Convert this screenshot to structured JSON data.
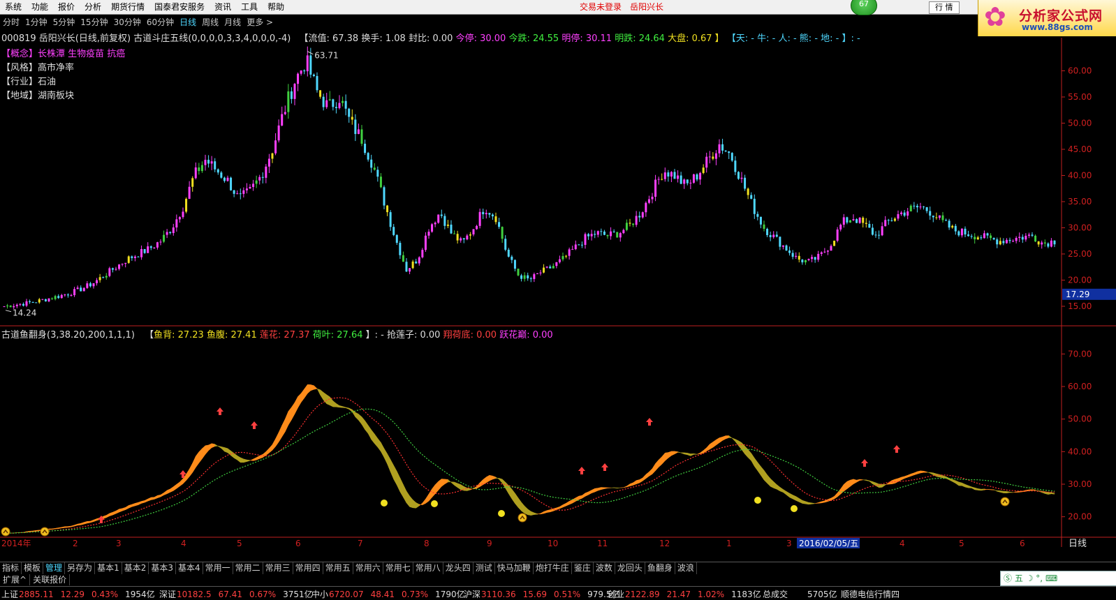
{
  "menu": [
    "系统",
    "功能",
    "报价",
    "分析",
    "期货行情",
    "国泰君安服务",
    "资讯",
    "工具",
    "帮助"
  ],
  "notice": [
    "交易未登录",
    "岳阳兴长"
  ],
  "badge": "67",
  "buttons": {
    "quote": "行 情"
  },
  "logo": {
    "title": "分析家公式网",
    "url": "www.88gs.com"
  },
  "periods": [
    "分时",
    "1分钟",
    "5分钟",
    "15分钟",
    "30分钟",
    "60分钟",
    "日线",
    "周线",
    "月线",
    "更多 >"
  ],
  "active_period": "日线",
  "main_info": {
    "code_name": "000819 岳阳兴长(日线,前复权)",
    "formula": "古道斗庄五线(0,0,0,0,3,3,4,0,0,0,-4)",
    "liutong": "【流值: 67.38",
    "huanshou": "换手: 1.08",
    "fengbi": "封比: 0.00",
    "jinting": "今停: 30.00",
    "jindie": "今跌: 24.55",
    "mingting": "明停: 30.11",
    "mingdie": "明跌: 24.64",
    "dapan": "大盘: 0.67 】",
    "tianren": "【天: - 牛: - 人: - 熊: - 地: - 】: -"
  },
  "tags": [
    {
      "key": "【概念】",
      "value": "长株潭 生物疫苗 抗癌"
    },
    {
      "key": "【风格】",
      "value": "高市净率"
    },
    {
      "key": "【行业】",
      "value": "石油"
    },
    {
      "key": "【地域】",
      "value": "湖南板块"
    }
  ],
  "chart_data": [
    {
      "type": "candlestick",
      "title": "000819 岳阳兴长(日线,前复权)",
      "ylim": [
        13,
        65
      ],
      "y_ticks": [
        15,
        20,
        25,
        30,
        35,
        40,
        45,
        50,
        55,
        60
      ],
      "y_tick_labels": [
        "15.00",
        "20.00",
        "25.00",
        "30.00",
        "35.00",
        "40.00",
        "45.00",
        "50.00",
        "55.00",
        "60.00"
      ],
      "annotations": {
        "high": "63.71",
        "low": "14.24",
        "current": "17.29"
      },
      "current_value": 17.29,
      "high_value": 63.71,
      "low_value": 14.24,
      "x_months": [
        "2014年",
        "2",
        "3",
        "4",
        "5",
        "6",
        "7",
        "8",
        "9",
        "10",
        "11",
        "12",
        "1",
        "2",
        "3",
        "4",
        "5",
        "6"
      ],
      "close_series": [
        15.0,
        15.3,
        15.6,
        16.0,
        16.5,
        17.0,
        17.6,
        18.4,
        19.5,
        21.0,
        22.5,
        24.0,
        25.0,
        26.0,
        27.5,
        30.0,
        34.0,
        40.0,
        43.0,
        41.0,
        39.0,
        35.5,
        37.0,
        40.0,
        45.0,
        52.0,
        58.0,
        62.0,
        56.0,
        53.0,
        55.0,
        50.0,
        47.0,
        42.0,
        35.0,
        28.0,
        22.0,
        24.0,
        30.0,
        33.0,
        29.0,
        27.0,
        30.0,
        34.0,
        32.0,
        25.0,
        21.0,
        20.0,
        21.5,
        22.5,
        24.0,
        26.0,
        28.0,
        29.0,
        28.5,
        29.0,
        30.5,
        33.0,
        37.0,
        41.0,
        40.0,
        38.0,
        40.0,
        43.0,
        46.0,
        44.0,
        39.0,
        34.0,
        30.0,
        28.0,
        26.0,
        24.0,
        23.5,
        24.5,
        27.0,
        31.0,
        32.0,
        30.5,
        28.5,
        31.0,
        32.5,
        33.5,
        34.0,
        33.0,
        31.0,
        29.5,
        29.0,
        28.5,
        28.0,
        27.5,
        27.8,
        28.2,
        28.5,
        27.0,
        27.5
      ]
    },
    {
      "type": "line",
      "title": "古道鱼翻身(3,38.20,200,1,1,1)",
      "ylim": [
        15,
        75
      ],
      "y_ticks": [
        20,
        30,
        40,
        50,
        60,
        70
      ],
      "y_tick_labels": [
        "20.00",
        "30.00",
        "40.00",
        "50.00",
        "60.00",
        "70.00"
      ],
      "series": [
        {
          "name": "鱼背",
          "value_label": "27.23",
          "color": "#ff8c1a"
        },
        {
          "name": "鱼腹",
          "value_label": "27.41",
          "color": "#b0a020"
        },
        {
          "name": "莲花",
          "value_label": "27.37",
          "color": "#ff3030"
        },
        {
          "name": "荷叶",
          "value_label": "27.64",
          "color": "#40d040"
        }
      ],
      "extra_labels": [
        {
          "text": "】: - 抢莲子: 0.00",
          "color": "#dedede"
        },
        {
          "text": "翔荷底: 0.00",
          "color": "#ff3030"
        },
        {
          "text": "跃花巅: 0.00",
          "color": "#ff40ff"
        }
      ],
      "date_cursor": "2016/02/05/五",
      "period_label": "日线"
    }
  ],
  "tabs": [
    "指标",
    "模板",
    "管理",
    "另存为",
    "基本1",
    "基本2",
    "基本3",
    "基本4",
    "常用一",
    "常用二",
    "常用三",
    "常用四",
    "常用五",
    "常用六",
    "常用七",
    "常用八",
    "龙头四",
    "测试",
    "快马加鞭",
    "炮打牛庄",
    "鉴庄",
    "波数",
    "龙回头",
    "鱼翻身",
    "波浪"
  ],
  "active_tab": "管理",
  "ext_tabs": [
    "扩展^",
    "关联报价"
  ],
  "ime_label": "五",
  "status": [
    {
      "name": "上证",
      "price": "2885.11",
      "chg": "12.29",
      "pct": "0.43%",
      "vol": "1954亿"
    },
    {
      "name": "深证",
      "price": "10182.5",
      "chg": "67.41",
      "pct": "0.67%",
      "vol": "3751亿"
    },
    {
      "name": "中小",
      "price": "6720.07",
      "chg": "48.41",
      "pct": "0.73%",
      "vol": "1790亿"
    },
    {
      "name": "沪深",
      "price": "3110.36",
      "chg": "15.69",
      "pct": "0.51%",
      "vol": "979.5亿"
    },
    {
      "name": "创业",
      "price": "2122.89",
      "chg": "21.47",
      "pct": "1.02%",
      "vol": "1183亿"
    }
  ],
  "status_tail": {
    "total_label": "总成交",
    "total": "5705亿",
    "server": "顺德电信行情四"
  },
  "colors": {
    "up": "#ff40ff",
    "down": "#4fd8ff",
    "ma_yellow": "#f0e020",
    "ma_green": "#40d040",
    "fish_back": "#ff8c1a",
    "fish_belly": "#b0a020",
    "lotus": "#ff3030",
    "leaf": "#40d040",
    "axis": "#c02020"
  }
}
